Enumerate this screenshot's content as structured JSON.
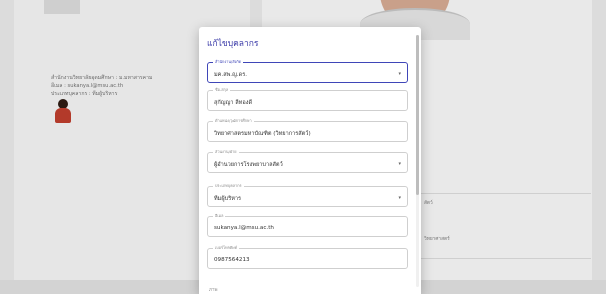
{
  "background": {
    "left_info_lines": [
      "สำนักงานวิทยาลัยอุดมศึกษา : ม.มหาสารคาม",
      "อีเมล : sukanya.l@msu.ac.th",
      "ประเภทบุคลากร : ทีมผู้บริหาร"
    ],
    "right_text_1": "สัตว์",
    "right_text_2": "วิทยาศาสตร์"
  },
  "modal": {
    "title": "แก้ไขบุคลากร",
    "fields": [
      {
        "label": "สำนักงาน/สังกัด",
        "value": "มค.สพ.ญ.ดร.",
        "type": "select"
      },
      {
        "label": "ชื่อ-สกุล",
        "value": "สุกัญญา ลีทองดี",
        "type": "text"
      },
      {
        "label": "ตำแหน่ง/วุฒิการศึกษา",
        "value": "วิทยาศาสตรมหาบัณฑิต (วิทยาการสัตว์)",
        "type": "text"
      },
      {
        "label": "ส่วนงาน/ฝ่าย",
        "value": "ผู้อำนวยการโรงพยาบาลสัตว์",
        "type": "select"
      },
      {
        "label": "ประเภทบุคลากร",
        "value": "ทีมผู้บริหาร",
        "type": "select"
      },
      {
        "label": "อีเมล",
        "value": "sukanya.l@msu.ac.th",
        "type": "text"
      },
      {
        "label": "เบอร์โทรศัพท์",
        "value": "0987564213",
        "type": "text"
      }
    ],
    "partial_next_label": "ภาพ"
  }
}
